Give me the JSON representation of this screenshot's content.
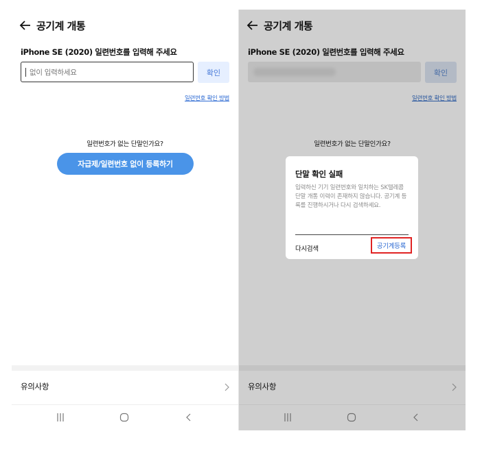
{
  "header": {
    "title": "공기계 개통"
  },
  "form": {
    "label": "iPhone SE (2020) 일련번호를 입력해 주세요",
    "placeholder": "없이 입력하세요",
    "confirm_label": "확인",
    "serial_help_link": "일련번호 확인 방법"
  },
  "no_serial": {
    "question": "일련번호가 없는 단말인가요?",
    "button_label": "자급제/일련번호 없이 등록하기"
  },
  "footer": {
    "notice_label": "유의사항"
  },
  "dialog": {
    "title": "단말 확인 실패",
    "body": "입력하신 기기 일련번호와 일치하는 SK텔레콤 단말 개통 이력이 존재하지 않습니다. 공기계 등록를 진행하시거나 다시 검색하세요.",
    "retry_label": "다시검색",
    "register_label": "공기계등록"
  },
  "colors": {
    "accent": "#4a94e8",
    "link": "#2e6bd3",
    "highlight": "#e02222",
    "overlay": "#cfcfcf"
  },
  "icons": [
    "back-arrow-icon",
    "chevron-right-icon",
    "recent-apps-icon",
    "home-icon",
    "nav-back-icon"
  ]
}
